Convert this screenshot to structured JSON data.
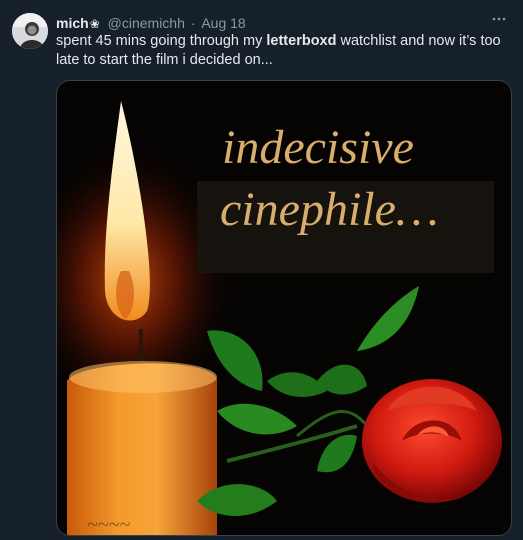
{
  "tweet": {
    "display_name": "mich",
    "name_flower": "❀",
    "handle": "@cinemichh",
    "separator": "·",
    "date": "Aug 18",
    "more_icon": "more-horizontal-icon",
    "text_before": "spent 45 mins going through my ",
    "text_bold": "letterboxd",
    "text_after": " watchlist and now it’s too late to start the film i decided on..."
  },
  "media": {
    "line1": "indecisive",
    "line2": "cinephile…",
    "caption_color": "#d9ad6b",
    "rose_color": "#c8170d",
    "flame_color": "#ffd46a"
  }
}
